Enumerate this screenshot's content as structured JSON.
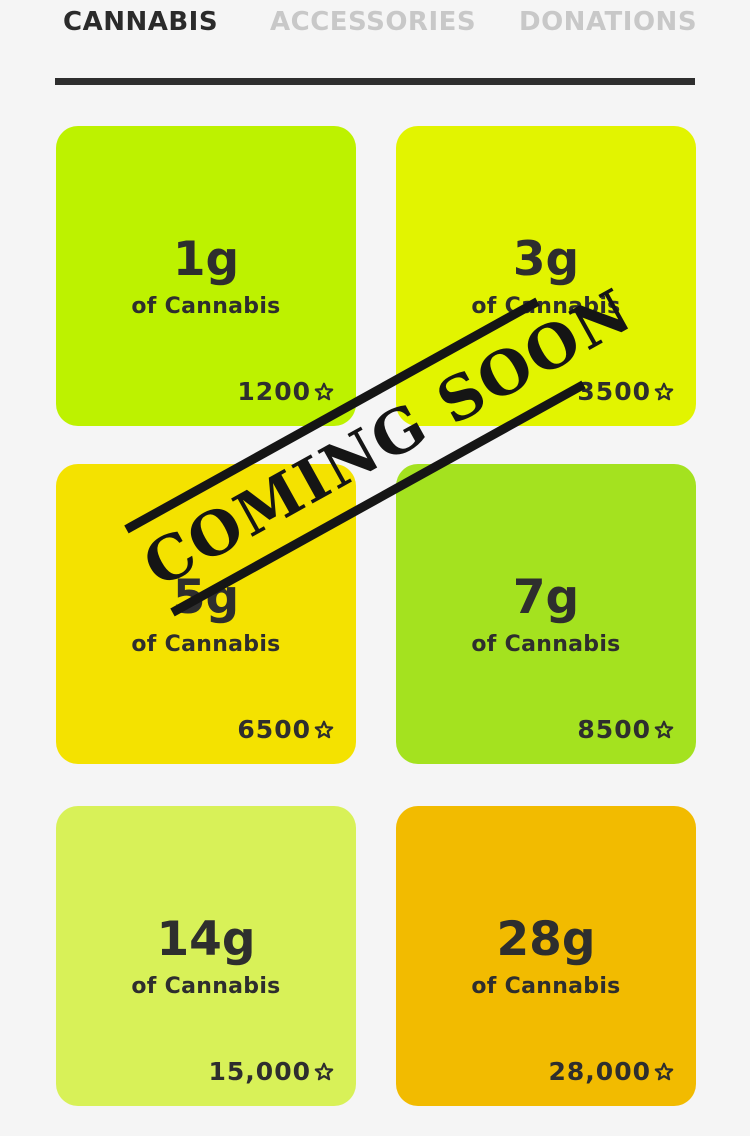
{
  "tabs": {
    "cannabis": "CANNABIS",
    "accessories": "ACCESSORIES",
    "donations": "DONATIONS",
    "active": "cannabis"
  },
  "stamp": {
    "text": "COMING SOON"
  },
  "products": [
    {
      "amount": "1g",
      "subtitle": "of Cannabis",
      "price": "1200",
      "color": "#bdf200",
      "icon": "flower-icon"
    },
    {
      "amount": "3g",
      "subtitle": "of Cannabis",
      "price": "3500",
      "color": "#e2f400",
      "icon": "flower-icon"
    },
    {
      "amount": "5g",
      "subtitle": "of Cannabis",
      "price": "6500",
      "color": "#f4e200",
      "icon": "flower-icon"
    },
    {
      "amount": "7g",
      "subtitle": "of Cannabis",
      "price": "8500",
      "color": "#a4e21f",
      "icon": "flower-icon"
    },
    {
      "amount": "14g",
      "subtitle": "of Cannabis",
      "price": "15,000",
      "color": "#d8f158",
      "icon": "flower-icon"
    },
    {
      "amount": "28g",
      "subtitle": "of Cannabis",
      "price": "28,000",
      "color": "#f2bb00",
      "icon": "flower-icon"
    }
  ]
}
